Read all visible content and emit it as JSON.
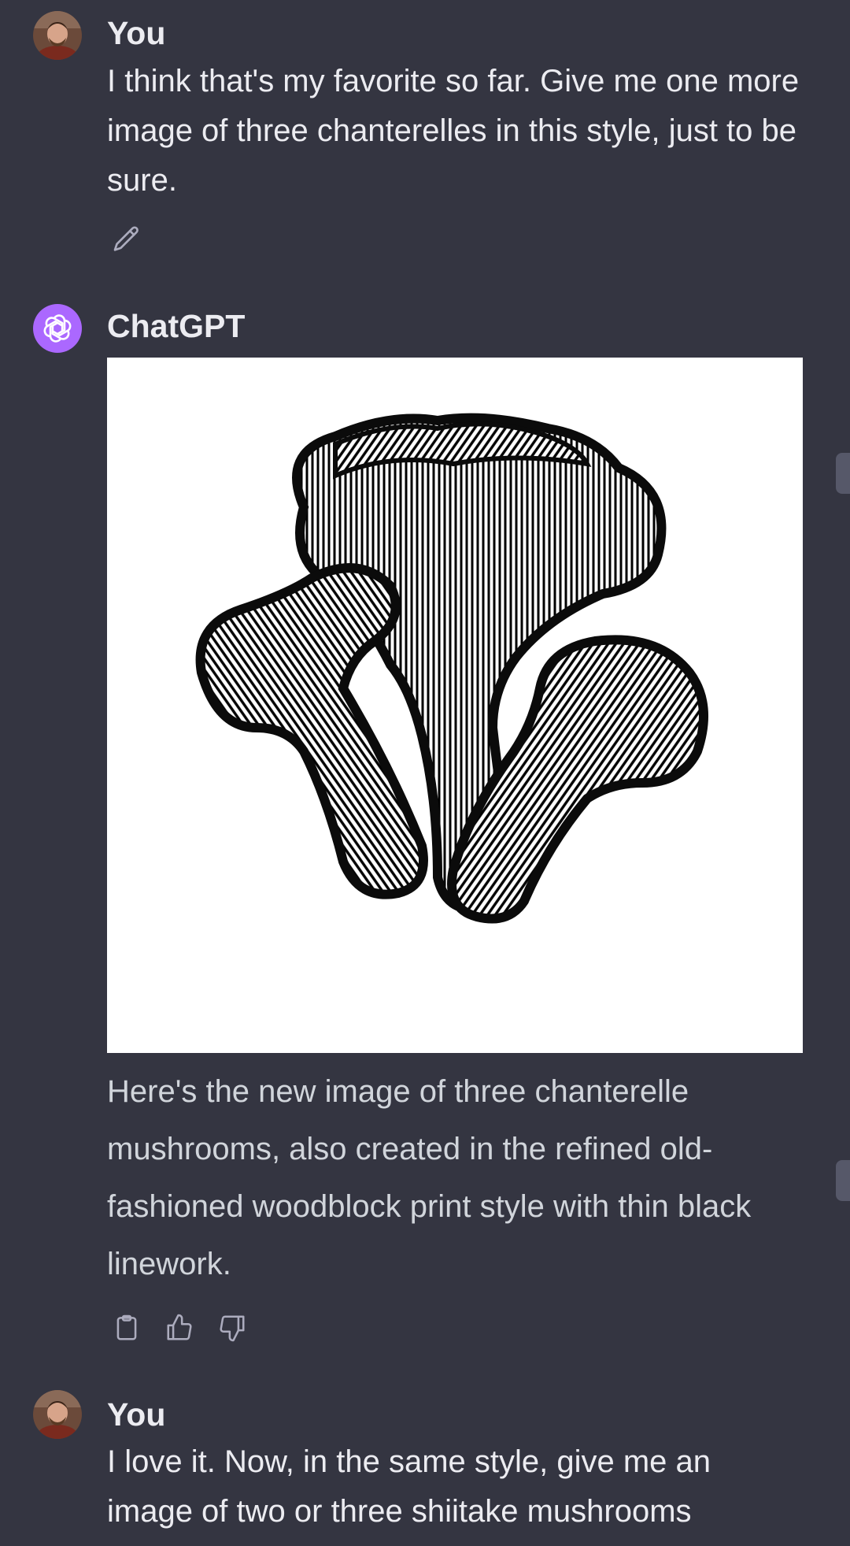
{
  "conversation": {
    "messages": [
      {
        "author": "You",
        "role": "user",
        "text": "I think that's my favorite so far.  Give me one more image of three chanterelles in this style, just to be sure.",
        "actions": [
          "pencil-icon"
        ]
      },
      {
        "author": "ChatGPT",
        "role": "assistant",
        "image": "three-chanterelle-mushrooms-woodblock-illustration",
        "text": "Here's the new image of three chanterelle mushrooms, also created in the refined old-fashioned woodblock print style with thin black linework.",
        "actions": [
          "clipboard-icon",
          "thumbs-up-icon",
          "thumbs-down-icon"
        ]
      },
      {
        "author": "You",
        "role": "user",
        "text": "I love it.  Now, in the same style, give me an image of two or three shiitake mushrooms"
      }
    ]
  },
  "colors": {
    "background": "#343541",
    "user_text": "#ececf1",
    "assistant_text": "#d1d5db",
    "chatgpt_avatar": "#ab68ff",
    "icon": "#acacbe"
  }
}
